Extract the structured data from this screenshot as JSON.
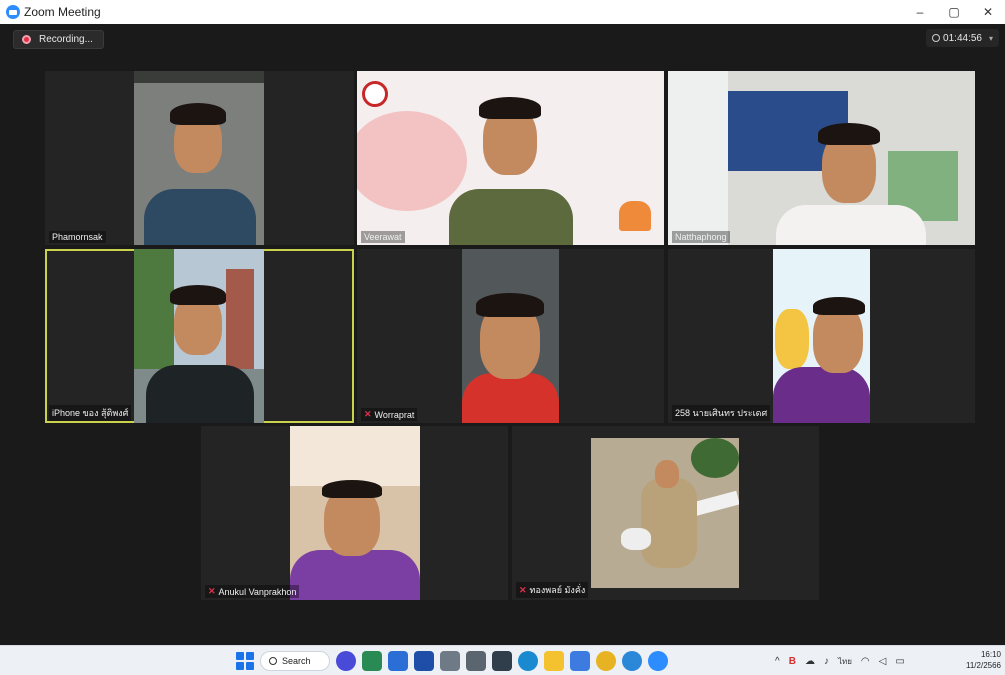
{
  "window": {
    "title": "Zoom Meeting",
    "controls": [
      "–",
      "▢",
      "✕"
    ]
  },
  "recording": {
    "label": "Recording..."
  },
  "timer": {
    "value": "01:44:56"
  },
  "participants": [
    {
      "name": "Phamornsak",
      "muted": false
    },
    {
      "name": "Veerawat",
      "muted": false
    },
    {
      "name": "Natthaphong",
      "muted": false
    },
    {
      "name": "iPhone ของ สุ้ติพงศ์",
      "muted": false,
      "active_speaker": true
    },
    {
      "name": "Worraprat",
      "muted": true
    },
    {
      "name": "258 นายเศินทร ประเดศ",
      "muted": false
    },
    {
      "name": "Anukul Vanprakhon",
      "muted": true
    },
    {
      "name": "ทองพลย์ มังคั่ง",
      "muted": true
    }
  ],
  "taskbar": {
    "search_label": "Search",
    "tray": {
      "language": "ไทย"
    },
    "clock": {
      "time": "16:10",
      "date": "11/2/2566"
    }
  },
  "colors": {
    "accent_active_speaker": "#c9d24a",
    "recording_dot": "#e0304a",
    "zoom_blue": "#2d8cff"
  }
}
